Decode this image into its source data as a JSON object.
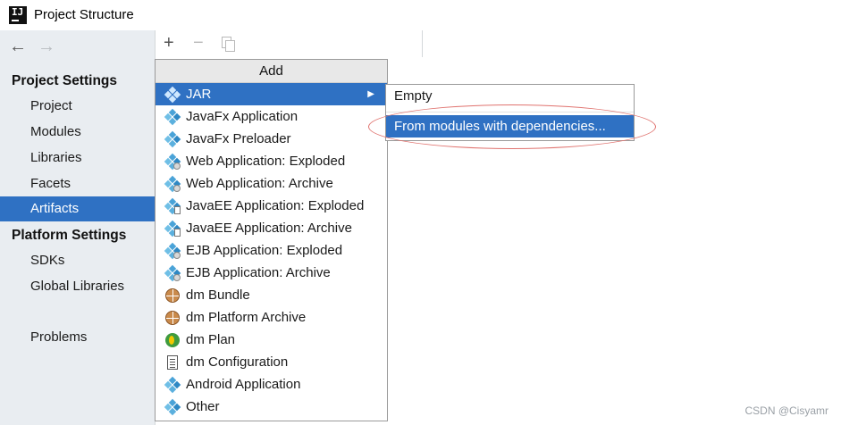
{
  "window": {
    "title": "Project Structure",
    "logo_text": "IJ"
  },
  "nav": {
    "back_glyph": "←",
    "forward_glyph": "→"
  },
  "sidebar": {
    "project_settings_heading": "Project Settings",
    "project_items": [
      {
        "label": "Project"
      },
      {
        "label": "Modules"
      },
      {
        "label": "Libraries"
      },
      {
        "label": "Facets"
      },
      {
        "label": "Artifacts",
        "selected": true
      }
    ],
    "platform_settings_heading": "Platform Settings",
    "platform_items": [
      {
        "label": "SDKs"
      },
      {
        "label": "Global Libraries"
      }
    ],
    "problems_label": "Problems"
  },
  "toolbar": {
    "add_glyph": "+",
    "remove_glyph": "−"
  },
  "add_popup": {
    "header": "Add",
    "items": [
      {
        "label": "JAR",
        "icon": "artifact-diamond-icon",
        "selected": true,
        "has_submenu": true
      },
      {
        "label": "JavaFx Application",
        "icon": "artifact-diamond-icon"
      },
      {
        "label": "JavaFx Preloader",
        "icon": "artifact-diamond-icon"
      },
      {
        "label": "Web Application: Exploded",
        "icon": "web-artifact-icon"
      },
      {
        "label": "Web Application: Archive",
        "icon": "web-artifact-icon"
      },
      {
        "label": "JavaEE Application: Exploded",
        "icon": "javaee-artifact-icon"
      },
      {
        "label": "JavaEE Application: Archive",
        "icon": "javaee-artifact-icon"
      },
      {
        "label": "EJB Application: Exploded",
        "icon": "ejb-artifact-icon"
      },
      {
        "label": "EJB Application: Archive",
        "icon": "ejb-artifact-icon"
      },
      {
        "label": "dm Bundle",
        "icon": "dm-bundle-icon"
      },
      {
        "label": "dm Platform Archive",
        "icon": "dm-platform-icon"
      },
      {
        "label": "dm Plan",
        "icon": "dm-plan-icon"
      },
      {
        "label": "dm Configuration",
        "icon": "dm-config-icon"
      },
      {
        "label": "Android Application",
        "icon": "artifact-diamond-icon"
      },
      {
        "label": "Other",
        "icon": "artifact-diamond-icon"
      }
    ],
    "submenu_arrow": "▶"
  },
  "jar_submenu": {
    "items": [
      {
        "label": "Empty"
      },
      {
        "label": "From modules with dependencies...",
        "selected": true
      }
    ]
  },
  "watermark": "CSDN @Cisyamr",
  "colors": {
    "selection": "#2f71c3",
    "sidebar_bg": "#e9edf1",
    "annotation_ellipse": "#e0736f"
  }
}
